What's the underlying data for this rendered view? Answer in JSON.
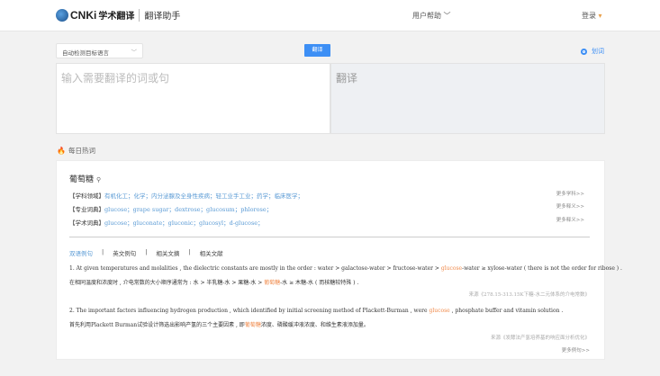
{
  "header": {
    "logo_text": "CNKi",
    "logo_cn": "学术翻译",
    "subtitle": "翻译助手",
    "help": "用户帮助",
    "login": "登录"
  },
  "toolbar": {
    "lang_select": "自动检测目标语言",
    "translate_button": "翻译",
    "huaci": "划词"
  },
  "input": {
    "placeholder": "输入需要翻译的词或句"
  },
  "output": {
    "label": "翻译"
  },
  "hot": {
    "title": "每日热词"
  },
  "card": {
    "word": "葡萄糖",
    "rows": [
      {
        "label": "【学科领域】",
        "value": "有机化工；化学；内分泌腺及全身性疾病；轻工业手工业；药学；临床医学；",
        "more": "更多学科>>"
      },
      {
        "label": "【专业词典】",
        "value": "glucose；grape sugar；dextrose；glucosum；phlorose；",
        "more": "更多释义>>"
      },
      {
        "label": "【学术词典】",
        "value": "glucose；gluconate；gluconic；glucosyl；d-glucose；",
        "more": "更多释义>>"
      }
    ],
    "tabs": [
      "双语例句",
      "|",
      "英文例句",
      "|",
      "相关文摘",
      "|",
      "相关文献"
    ],
    "sentences": [
      {
        "en_pre": "1. At given temperatures and molalities , the dielectric constants are mostly in the order : water > galactose-water > fructose-water > ",
        "en_hl": "glucose",
        "en_post": "-water ≥ xylose-water ( there is not the order for ribose ) .",
        "cn_pre": "在相同温度和浓度时 , 介电常数的大小顺序通常为 : 水 > 半乳糖-水 > 果糖-水 > ",
        "cn_hl": "葡萄糖",
        "cn_post": "-水 ≥ 木糖-水 ( 而核糖较特殊 ) .",
        "source": "来源《278.15-313.15K下糖-水二元体系的介电常数》"
      },
      {
        "en_pre": "2. The important factors influencing hydrogen production , which identified by initial screening method of Plackett-Burman , were ",
        "en_hl": "glucose",
        "en_post": " , phosphate buffer and vitamin solution .",
        "cn_pre": "首先利用Plackett Burman试验设计筛选出影响产氢的三个主要因素 , 即",
        "cn_hl": "葡萄糖",
        "cn_post": "浓度、磷酸缓冲液浓度、和维生素液添加量。",
        "source": "来源《发酵法产氢培养基的响应面分析优化》"
      }
    ],
    "more_examples": "更多例句>>"
  }
}
